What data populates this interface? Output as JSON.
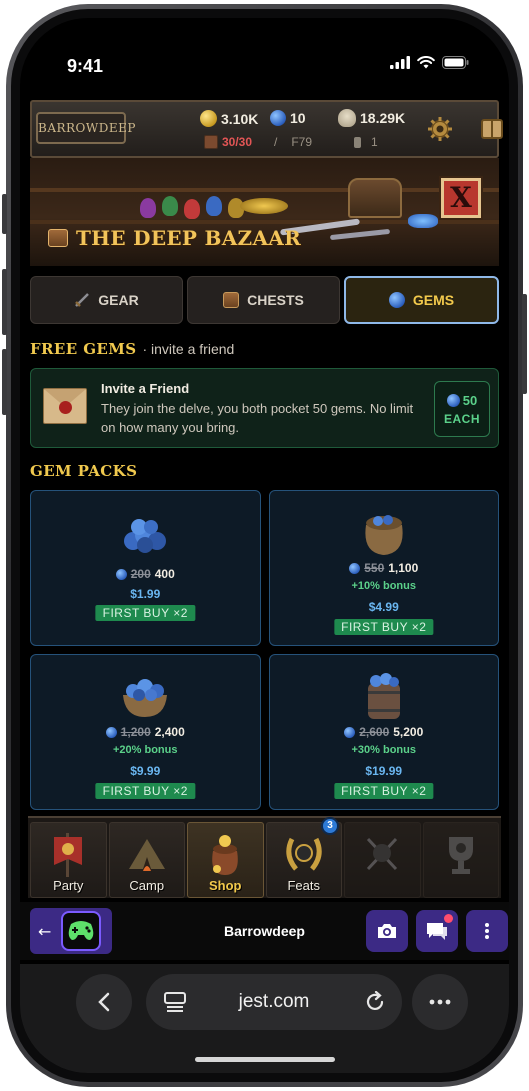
{
  "status": {
    "time": "9:41"
  },
  "resources": {
    "gold": "3.10K",
    "gems": "10",
    "souls": "18.29K",
    "energy": "30/30",
    "floor": "F79",
    "keys": "1"
  },
  "logo": {
    "text": "BARROWDEEP"
  },
  "banner": {
    "title": "THE DEEP BAZAAR",
    "close_label": "X"
  },
  "tabs": [
    {
      "label": "GEAR",
      "active": false
    },
    {
      "label": "CHESTS",
      "active": false
    },
    {
      "label": "GEMS",
      "active": true
    }
  ],
  "free_gems": {
    "heading": "FREE GEMS",
    "subheading": "· invite a friend",
    "invite_title": "Invite a Friend",
    "invite_desc": "They join the delve, you both pocket 50 gems. No limit on how many you bring.",
    "reward_amount": "50",
    "reward_label": "EACH"
  },
  "gem_packs": {
    "heading": "GEM PACKS",
    "packs": [
      {
        "old": "200",
        "amount": "400",
        "bonus": "",
        "price": "$1.99",
        "tag": "FIRST BUY ×2"
      },
      {
        "old": "550",
        "amount": "1,100",
        "bonus": "+10% bonus",
        "price": "$4.99",
        "tag": "FIRST BUY ×2"
      },
      {
        "old": "1,200",
        "amount": "2,400",
        "bonus": "+20% bonus",
        "price": "$9.99",
        "tag": "FIRST BUY ×2"
      },
      {
        "old": "2,600",
        "amount": "5,200",
        "bonus": "+30% bonus",
        "price": "$19.99",
        "tag": "FIRST BUY ×2"
      }
    ]
  },
  "game_nav": [
    {
      "label": "Party"
    },
    {
      "label": "Camp"
    },
    {
      "label": "Shop"
    },
    {
      "label": "Feats",
      "badge": "3"
    },
    {
      "label": ""
    },
    {
      "label": ""
    }
  ],
  "jest": {
    "title": "Barrowdeep"
  },
  "browser": {
    "url": "jest.com"
  },
  "colors": {
    "accent_gold": "#f2c94c",
    "bonus_green": "#5bd18a",
    "price_blue": "#6ab6f0",
    "jest_purple": "#3c2a85"
  }
}
